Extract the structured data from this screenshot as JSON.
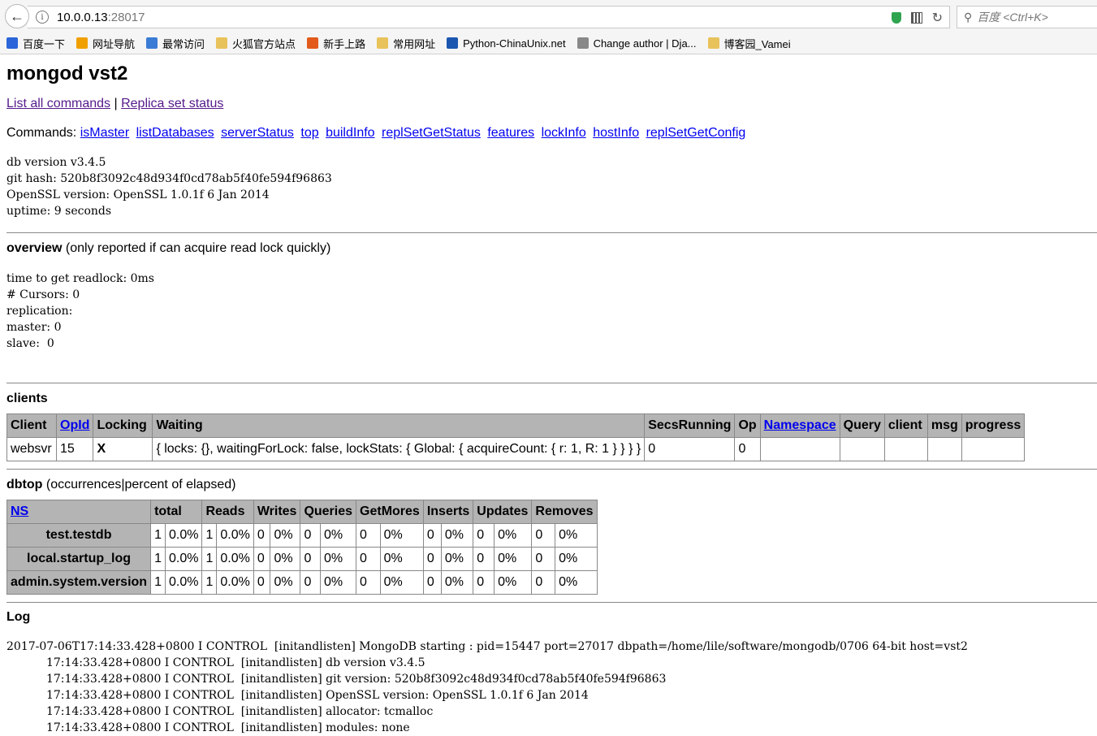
{
  "browser": {
    "url_host": "10.0.0.13",
    "url_port": ":28017",
    "search_placeholder": "百度 <Ctrl+K>",
    "bookmarks": [
      {
        "label": "百度一下",
        "color": "#2b65d9"
      },
      {
        "label": "网址导航",
        "color": "#f0a000"
      },
      {
        "label": "最常访问",
        "color": "#3a7bd5"
      },
      {
        "label": "火狐官方站点",
        "color": "#e8c25a"
      },
      {
        "label": "新手上路",
        "color": "#e25a1c"
      },
      {
        "label": "常用网址",
        "color": "#e8c25a"
      },
      {
        "label": "Python-ChinaUnix.net",
        "color": "#1a56b0"
      },
      {
        "label": "Change author | Dja...",
        "color": "#888888"
      },
      {
        "label": "博客园_Vamei",
        "color": "#e8c25a"
      }
    ]
  },
  "page": {
    "title": "mongod vst2",
    "links": {
      "list_all": "List all commands",
      "sep": " | ",
      "replica": "Replica set status"
    },
    "commands_label": "Commands:",
    "commands": [
      "isMaster",
      "listDatabases",
      "serverStatus",
      "top",
      "buildInfo",
      "replSetGetStatus",
      "features",
      "lockInfo",
      "hostInfo",
      "replSetGetConfig"
    ],
    "version_block": "db version v3.4.5\ngit hash: 520b8f3092c48d934f0cd78ab5f40fe594f96863\nOpenSSL version: OpenSSL 1.0.1f 6 Jan 2014\nuptime: 9 seconds",
    "overview": {
      "heading": "overview",
      "note": " (only reported if can acquire read lock quickly)",
      "body": "time to get readlock: 0ms\n# Cursors: 0\nreplication:\nmaster: 0\nslave:  0"
    },
    "clients": {
      "heading": "clients",
      "headers": [
        "Client",
        "OpId",
        "Locking",
        "Waiting",
        "SecsRunning",
        "Op",
        "Namespace",
        "Query",
        "client",
        "msg",
        "progress"
      ],
      "row": [
        "websvr",
        "15",
        "X",
        "{ locks: {}, waitingForLock: false, lockStats: { Global: { acquireCount: { r: 1, R: 1 } } } }",
        "0",
        "0",
        "",
        "",
        "",
        "",
        ""
      ]
    },
    "dbtop": {
      "heading": "dbtop",
      "note": " (occurrences|percent of elapsed)",
      "headers": [
        "NS",
        "total",
        "Reads",
        "Writes",
        "Queries",
        "GetMores",
        "Inserts",
        "Updates",
        "Removes"
      ],
      "rows": [
        {
          "ns": "test.testdb",
          "vals": [
            "1",
            "0.0%",
            "1",
            "0.0%",
            "0",
            "0%",
            "0",
            "0%",
            "0",
            "0%",
            "0",
            "0%",
            "0",
            "0%",
            "0",
            "0%"
          ]
        },
        {
          "ns": "local.startup_log",
          "vals": [
            "1",
            "0.0%",
            "1",
            "0.0%",
            "0",
            "0%",
            "0",
            "0%",
            "0",
            "0%",
            "0",
            "0%",
            "0",
            "0%",
            "0",
            "0%"
          ]
        },
        {
          "ns": "admin.system.version",
          "vals": [
            "1",
            "0.0%",
            "1",
            "0.0%",
            "0",
            "0%",
            "0",
            "0%",
            "0",
            "0%",
            "0",
            "0%",
            "0",
            "0%",
            "0",
            "0%"
          ]
        }
      ]
    },
    "log": {
      "heading": "Log",
      "body": "2017-07-06T17:14:33.428+0800 I CONTROL  [initandlisten] MongoDB starting : pid=15447 port=27017 dbpath=/home/lile/software/mongodb/0706 64-bit host=vst2\n           17:14:33.428+0800 I CONTROL  [initandlisten] db version v3.4.5\n           17:14:33.428+0800 I CONTROL  [initandlisten] git version: 520b8f3092c48d934f0cd78ab5f40fe594f96863\n           17:14:33.428+0800 I CONTROL  [initandlisten] OpenSSL version: OpenSSL 1.0.1f 6 Jan 2014\n           17:14:33.428+0800 I CONTROL  [initandlisten] allocator: tcmalloc\n           17:14:33.428+0800 I CONTROL  [initandlisten] modules: none"
    }
  }
}
